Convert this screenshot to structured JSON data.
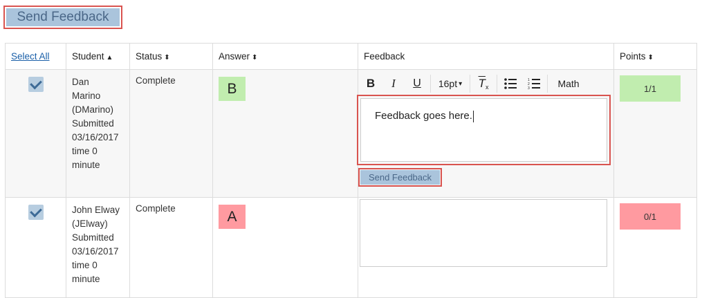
{
  "top_send_label": "Send Feedback",
  "headers": {
    "select_all": "Select All",
    "student": "Student",
    "student_sort": "▲",
    "status": "Status",
    "answer": "Answer",
    "feedback": "Feedback",
    "points": "Points",
    "sort_icon": "⬍"
  },
  "toolbar": {
    "bold": "B",
    "italic": "I",
    "underline": "U",
    "font_size": "16pt",
    "font_size_caret": "▾",
    "clear_format": "T",
    "math": "Math"
  },
  "rows": [
    {
      "checked": true,
      "student_lines": [
        "Dan",
        "Marino",
        "(DMarino)",
        "Submitted",
        "03/16/2017",
        "time 0",
        "minute"
      ],
      "status": "Complete",
      "answer": "B",
      "feedback_text": "Feedback goes here.",
      "send_label": "Send Feedback",
      "points": "1/1"
    },
    {
      "checked": true,
      "student_lines": [
        "John Elway",
        "(JElway)",
        "Submitted",
        "03/16/2017",
        "time 0",
        "minute"
      ],
      "status": "Complete",
      "answer": "A",
      "feedback_text": "",
      "points": "0/1"
    }
  ],
  "colors": {
    "correct": "#c1edaf",
    "incorrect": "#ff9aa0",
    "button_bg": "#aac4dc",
    "highlight_border": "#d9534f"
  }
}
